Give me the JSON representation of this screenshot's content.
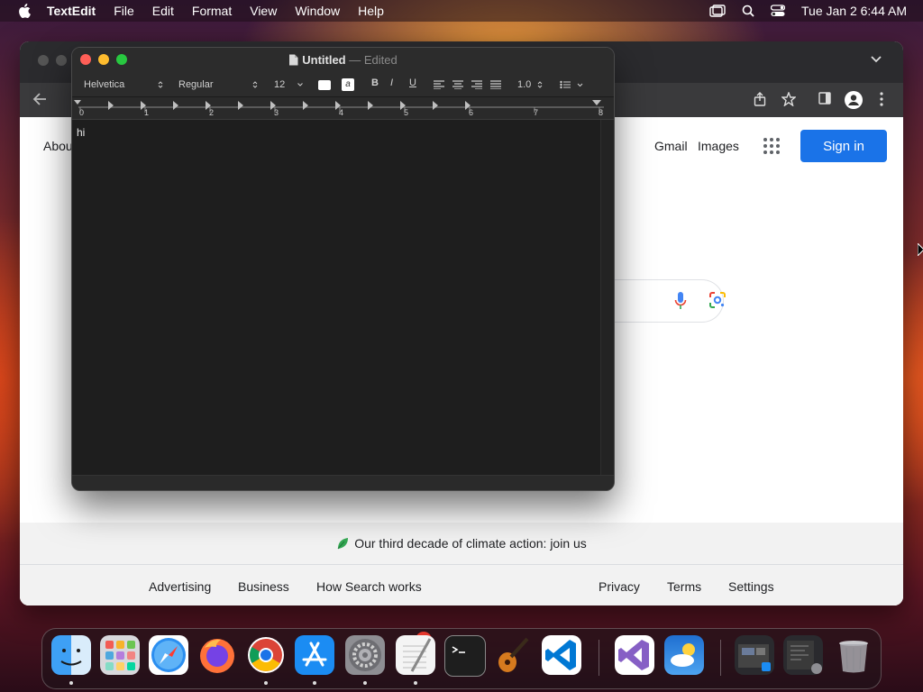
{
  "menubar": {
    "app_name": "TextEdit",
    "items": [
      "File",
      "Edit",
      "Format",
      "View",
      "Window",
      "Help"
    ],
    "clock": "Tue Jan 2  6:44 AM"
  },
  "browser": {
    "page": {
      "about_label": "Abou",
      "gmail_label": "Gmail",
      "images_label": "Images",
      "signin_label": "Sign in",
      "climate_text": "Our third decade of climate action: join us",
      "footer_left": [
        "Advertising",
        "Business",
        "How Search works"
      ],
      "footer_right": [
        "Privacy",
        "Terms",
        "Settings"
      ],
      "colors": {
        "signin": "#1a73e8"
      }
    }
  },
  "textedit": {
    "title": "Untitled",
    "separator": "—",
    "status": "Edited",
    "font_family": "Helvetica",
    "font_style": "Regular",
    "font_size": "12",
    "line_spacing": "1.0",
    "format_buttons": [
      "B",
      "I",
      "U"
    ],
    "ruler_numbers": [
      "0",
      "1",
      "2",
      "3",
      "4",
      "5",
      "6",
      "7",
      "8"
    ],
    "document_text": "hi"
  },
  "dock": {
    "apps": [
      "Finder",
      "Launchpad",
      "Safari",
      "Firefox",
      "Chrome",
      "App Store",
      "System Settings",
      "TextEdit",
      "Terminal",
      "GarageBand",
      "Visual Studio Code",
      "Visual Studio",
      "Weather",
      "Downloads Stack",
      "Recent Stack",
      "Trash"
    ],
    "settings_badge": "1"
  }
}
